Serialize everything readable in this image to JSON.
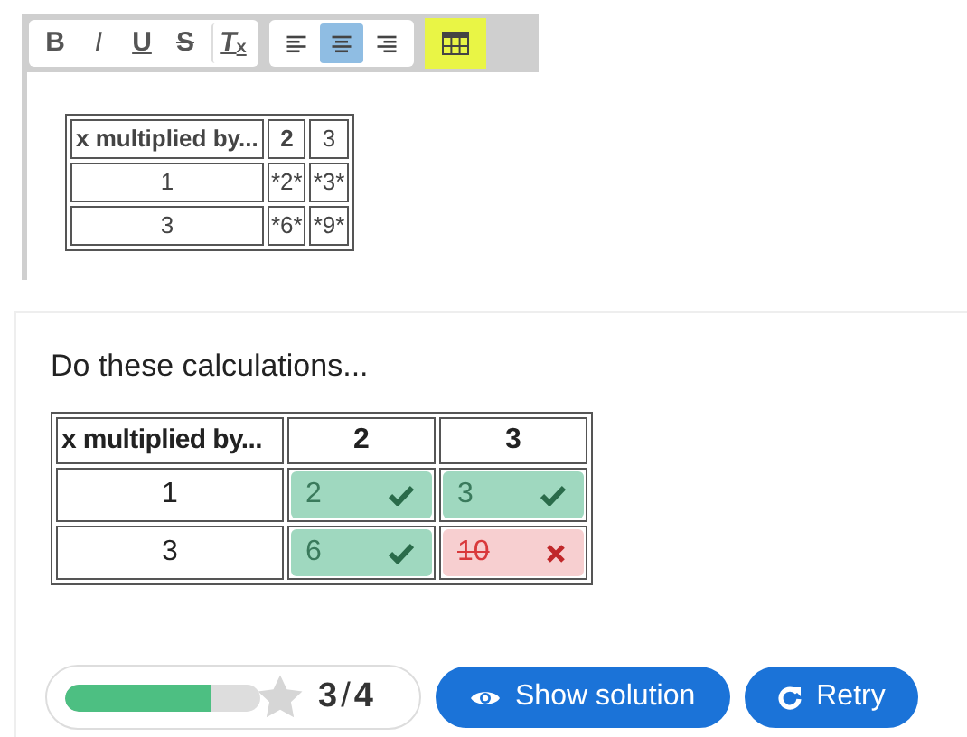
{
  "editor": {
    "toolbar": [
      {
        "kind": "bold",
        "label": "B",
        "selected": false
      },
      {
        "kind": "italic",
        "label": "I",
        "selected": false
      },
      {
        "kind": "underline",
        "label": "U",
        "selected": false
      },
      {
        "kind": "strike",
        "label": "S",
        "selected": false
      },
      {
        "kind": "clear",
        "label": "T",
        "sub": "x",
        "selected": false
      },
      {
        "kind": "align-left",
        "selected": false
      },
      {
        "kind": "align-center",
        "selected": true
      },
      {
        "kind": "align-right",
        "selected": false
      },
      {
        "kind": "table",
        "selected": true
      }
    ],
    "table": {
      "columns": [
        "x multiplied by...",
        "2",
        "3"
      ],
      "rows": [
        [
          "1",
          "*2*",
          "*3*"
        ],
        [
          "3",
          "*6*",
          "*9*"
        ]
      ]
    }
  },
  "quiz": {
    "prompt": "Do these calculations...",
    "table": {
      "columns": [
        "x multiplied by...",
        "2",
        "3"
      ],
      "rows": [
        {
          "label": "1",
          "answers": [
            {
              "value": "2",
              "correct": true
            },
            {
              "value": "3",
              "correct": true
            }
          ]
        },
        {
          "label": "3",
          "answers": [
            {
              "value": "6",
              "correct": true
            },
            {
              "value": "10",
              "correct": false
            }
          ]
        }
      ]
    },
    "score": {
      "level": 0.75,
      "text": "3",
      "separator": "/",
      "max": "4"
    },
    "buttons": [
      {
        "kind": "show",
        "label": "Show solution"
      },
      {
        "kind": "retry",
        "label": "Retry"
      }
    ]
  }
}
